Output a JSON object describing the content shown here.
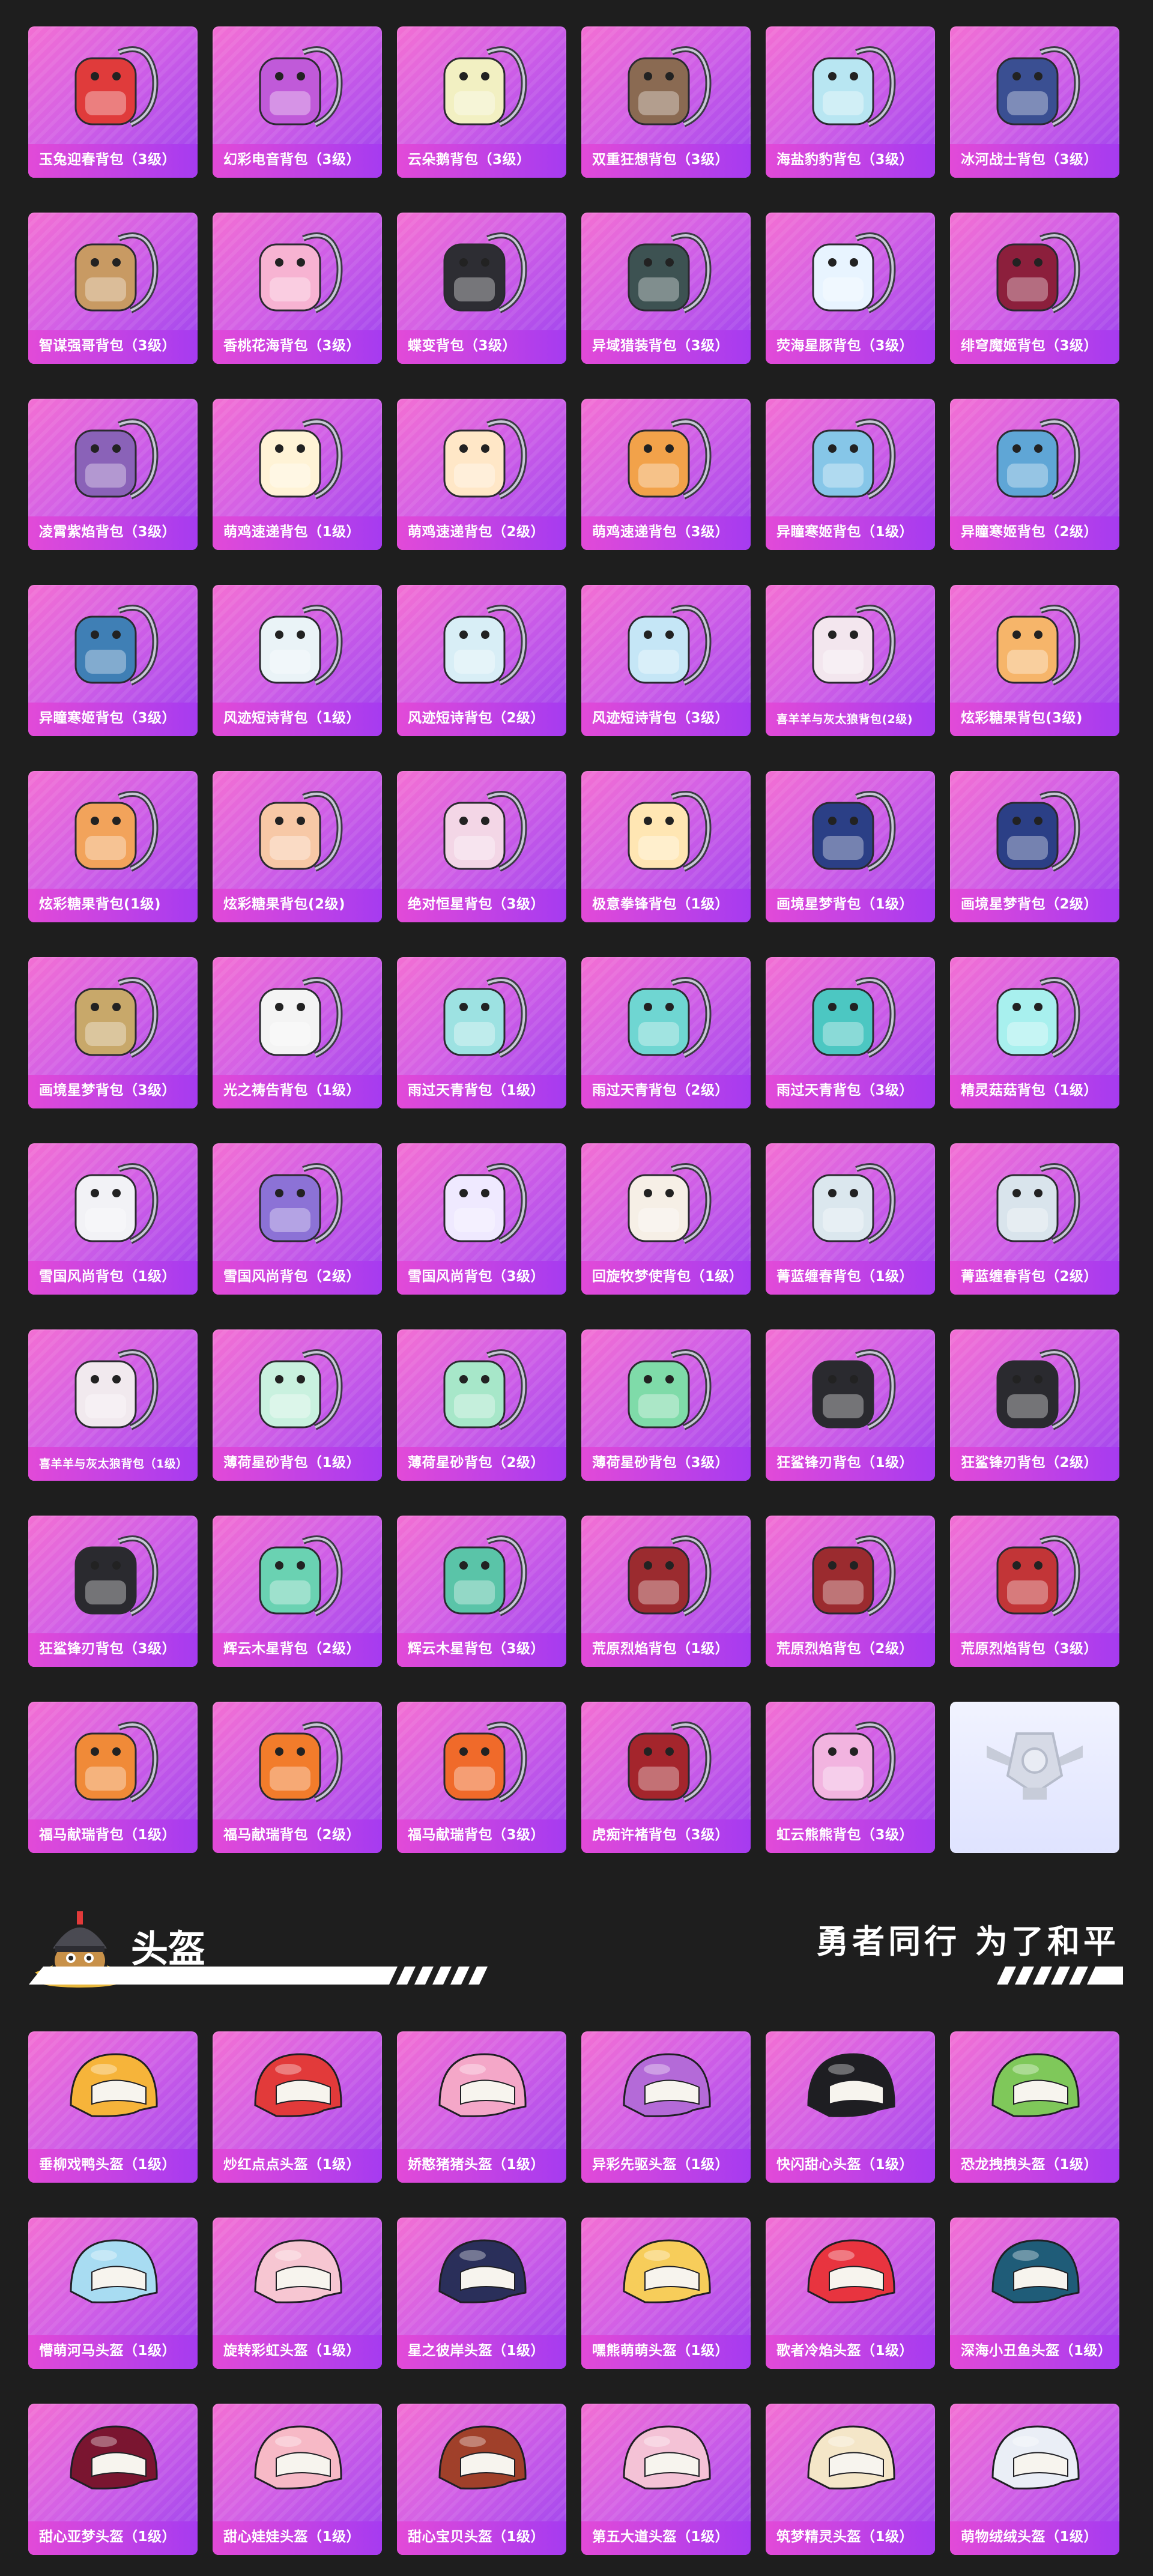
{
  "backpacks": [
    {
      "label": "玉兔迎春背包（3级）",
      "icon": "backpack-icon",
      "color": "#e03b3b"
    },
    {
      "label": "幻彩电音背包（3级）",
      "icon": "backpack-icon",
      "color": "#c05ad9"
    },
    {
      "label": "云朵鹅背包（3级）",
      "icon": "backpack-icon",
      "color": "#f2f0c2"
    },
    {
      "label": "双重狂想背包（3级）",
      "icon": "backpack-icon",
      "color": "#8a6a52"
    },
    {
      "label": "海盐豹豹背包（3级）",
      "icon": "backpack-icon",
      "color": "#b8e6f2"
    },
    {
      "label": "冰河战士背包（3级）",
      "icon": "backpack-icon",
      "color": "#3a4f92"
    },
    {
      "label": "智谋强哥背包（3级）",
      "icon": "backpack-icon",
      "color": "#c89a63"
    },
    {
      "label": "香桃花海背包（3级）",
      "icon": "backpack-icon",
      "color": "#f7b3d2"
    },
    {
      "label": "蝶变背包（3级）",
      "icon": "backpack-icon",
      "color": "#2d2d33"
    },
    {
      "label": "异域猎装背包（3级）",
      "icon": "backpack-icon",
      "color": "#3d5252"
    },
    {
      "label": "荧海星豚背包（3级）",
      "icon": "backpack-icon",
      "color": "#e8f4ff"
    },
    {
      "label": "绯穹魔姬背包（3级）",
      "icon": "backpack-icon",
      "color": "#8c1f3c"
    },
    {
      "label": "凌霄紫焰背包（3级）",
      "icon": "backpack-icon",
      "color": "#8a62b8"
    },
    {
      "label": "萌鸡速递背包（1级）",
      "icon": "backpack-icon",
      "color": "#fff3d6"
    },
    {
      "label": "萌鸡速递背包（2级）",
      "icon": "backpack-icon",
      "color": "#ffe7c7"
    },
    {
      "label": "萌鸡速递背包（3级）",
      "icon": "backpack-icon",
      "color": "#f2a24a"
    },
    {
      "label": "异瞳寒姬背包（1级）",
      "icon": "backpack-icon",
      "color": "#86c6e8"
    },
    {
      "label": "异瞳寒姬背包（2级）",
      "icon": "backpack-icon",
      "color": "#5fa6d6"
    },
    {
      "label": "异瞳寒姬背包（3级）",
      "icon": "backpack-icon",
      "color": "#3f7fb5"
    },
    {
      "label": "风迹短诗背包（1级）",
      "icon": "backpack-icon",
      "color": "#eaf3f7"
    },
    {
      "label": "风迹短诗背包（2级）",
      "icon": "backpack-icon",
      "color": "#d8eef6"
    },
    {
      "label": "风迹短诗背包（3级）",
      "icon": "backpack-icon",
      "color": "#c5e6f6"
    },
    {
      "label": "喜羊羊与灰太狼背包(2级)",
      "icon": "backpack-icon",
      "color": "#f3e6ee"
    },
    {
      "label": "炫彩糖果背包(3级)",
      "icon": "backpack-icon",
      "color": "#f6b56a"
    },
    {
      "label": "炫彩糖果背包(1级)",
      "icon": "backpack-icon",
      "color": "#f2a35b"
    },
    {
      "label": "炫彩糖果背包(2级)",
      "icon": "backpack-icon",
      "color": "#f7c8a6"
    },
    {
      "label": "绝对恒星背包（3级）",
      "icon": "backpack-icon",
      "color": "#f3d6e6"
    },
    {
      "label": "极意拳锋背包（1级）",
      "icon": "backpack-icon",
      "color": "#ffe6b3"
    },
    {
      "label": "画境星梦背包（1级）",
      "icon": "backpack-icon",
      "color": "#2b3f86"
    },
    {
      "label": "画境星梦背包（2级）",
      "icon": "backpack-icon",
      "color": "#2b3f86"
    },
    {
      "label": "画境星梦背包（3级）",
      "icon": "backpack-icon",
      "color": "#c8a86a"
    },
    {
      "label": "光之祷告背包（1级）",
      "icon": "backpack-icon",
      "color": "#f4f4f4"
    },
    {
      "label": "雨过天青背包（1级）",
      "icon": "backpack-icon",
      "color": "#9de2e2"
    },
    {
      "label": "雨过天青背包（2级）",
      "icon": "backpack-icon",
      "color": "#6fd6d2"
    },
    {
      "label": "雨过天青背包（3级）",
      "icon": "backpack-icon",
      "color": "#4cc7c2"
    },
    {
      "label": "精灵菇菇背包（1级）",
      "icon": "backpack-icon",
      "color": "#a8f0ee"
    },
    {
      "label": "雪国风尚背包（1级）",
      "icon": "backpack-icon",
      "color": "#f2f2f6"
    },
    {
      "label": "雪国风尚背包（2级）",
      "icon": "backpack-icon",
      "color": "#8c72d6"
    },
    {
      "label": "雪国风尚背包（3级）",
      "icon": "backpack-icon",
      "color": "#efe9ff"
    },
    {
      "label": "回旋牧梦使背包（1级）",
      "icon": "backpack-icon",
      "color": "#f6efe6"
    },
    {
      "label": "菁蓝缠春背包（1级）",
      "icon": "backpack-icon",
      "color": "#dbe7ee"
    },
    {
      "label": "菁蓝缠春背包（2级）",
      "icon": "backpack-icon",
      "color": "#d9e4ec"
    },
    {
      "label": "喜羊羊与灰太狼背包（1级）",
      "icon": "backpack-icon",
      "color": "#f1e9ee"
    },
    {
      "label": "薄荷星砂背包（1级）",
      "icon": "backpack-icon",
      "color": "#c9f1df"
    },
    {
      "label": "薄荷星砂背包（2级）",
      "icon": "backpack-icon",
      "color": "#a7e7c9"
    },
    {
      "label": "薄荷星砂背包（3级）",
      "icon": "backpack-icon",
      "color": "#7fdba9"
    },
    {
      "label": "狂鲨锋刃背包（1级）",
      "icon": "backpack-icon",
      "color": "#2a2a2f"
    },
    {
      "label": "狂鲨锋刃背包（2级）",
      "icon": "backpack-icon",
      "color": "#2a2a2f"
    },
    {
      "label": "狂鲨锋刃背包（3级）",
      "icon": "backpack-icon",
      "color": "#2a2a2f"
    },
    {
      "label": "辉云木星背包（2级）",
      "icon": "backpack-icon",
      "color": "#6ad2b2"
    },
    {
      "label": "辉云木星背包（3级）",
      "icon": "backpack-icon",
      "color": "#5ac4a8"
    },
    {
      "label": "荒原烈焰背包（1级）",
      "icon": "backpack-icon",
      "color": "#9b2b2f"
    },
    {
      "label": "荒原烈焰背包（2级）",
      "icon": "backpack-icon",
      "color": "#9b2b2f"
    },
    {
      "label": "荒原烈焰背包（3级）",
      "icon": "backpack-icon",
      "color": "#c23537"
    },
    {
      "label": "福马献瑞背包（1级）",
      "icon": "backpack-icon",
      "color": "#f08a38"
    },
    {
      "label": "福马献瑞背包（2级）",
      "icon": "backpack-icon",
      "color": "#f27c2b"
    },
    {
      "label": "福马献瑞背包（3级）",
      "icon": "backpack-icon",
      "color": "#f06a2a"
    },
    {
      "label": "虎痴许褚背包（3级）",
      "icon": "backpack-icon",
      "color": "#a4252c"
    },
    {
      "label": "虹云熊熊背包（3级）",
      "icon": "backpack-icon",
      "color": "#f2b4e0"
    },
    {
      "label": "",
      "icon": "emblem-icon",
      "color": "#c7ccd9",
      "placeholder": true
    }
  ],
  "section": {
    "title": "头盔",
    "slogan": "勇者同行 为了和平"
  },
  "helmets": [
    {
      "label": "垂柳戏鸭头盔（1级）",
      "color": "#f6b43a"
    },
    {
      "label": "炒红点点头盔（1级）",
      "color": "#e23a3a"
    },
    {
      "label": "娇憨猪猪头盔（1级）",
      "color": "#f4a7c8"
    },
    {
      "label": "异彩先驱头盔（1级）",
      "color": "#b46ad8"
    },
    {
      "label": "快闪甜心头盔（1级）",
      "color": "#1e1e22"
    },
    {
      "label": "恐龙拽拽头盔（1级）",
      "color": "#7fc85a"
    },
    {
      "label": "懵萌河马头盔（1级）",
      "color": "#a8dcf2"
    },
    {
      "label": "旋转彩虹头盔（1级）",
      "color": "#f7c6d2"
    },
    {
      "label": "星之彼岸头盔（1级）",
      "color": "#2a2f5a"
    },
    {
      "label": "嘿熊萌萌头盔（1级）",
      "color": "#f7cd5a"
    },
    {
      "label": "歌者冷焰头盔（1级）",
      "color": "#e8343f"
    },
    {
      "label": "深海小丑鱼头盔（1级）",
      "color": "#1f5c78"
    },
    {
      "label": "甜心亚梦头盔（1级）",
      "color": "#7a1530"
    },
    {
      "label": "甜心娃娃头盔（1级）",
      "color": "#f7b9c6"
    },
    {
      "label": "甜心宝贝头盔（1级）",
      "color": "#a0402a"
    },
    {
      "label": "第五大道头盔（1级）",
      "color": "#f4c2d6"
    },
    {
      "label": "筑梦精灵头盔（1级）",
      "color": "#f4e6c8"
    },
    {
      "label": "萌物绒绒头盔（1级）",
      "color": "#eaeef6"
    }
  ]
}
